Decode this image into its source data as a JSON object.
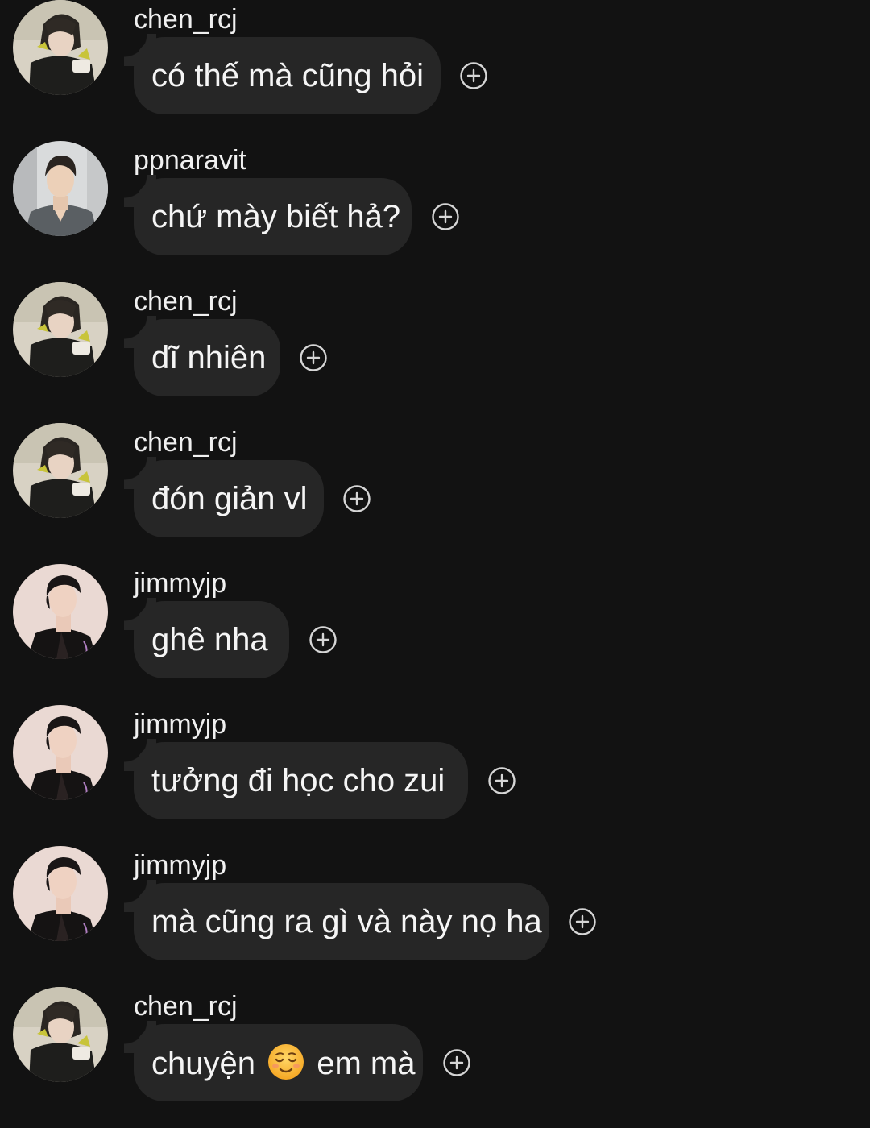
{
  "messages": [
    {
      "username": "chen_rcj",
      "text": "có thế mà cũng hỏi",
      "avatar": "chen-avatar"
    },
    {
      "username": "ppnaravit",
      "text": "chứ mày biết hả?",
      "avatar": "ppnaravit-avatar"
    },
    {
      "username": "chen_rcj",
      "text": "dĩ nhiên",
      "avatar": "chen-avatar"
    },
    {
      "username": "chen_rcj",
      "text": "đón giản vl",
      "avatar": "chen-avatar"
    },
    {
      "username": "jimmyjp",
      "text": "ghê nha",
      "avatar": "jimmy-avatar"
    },
    {
      "username": "jimmyjp",
      "text": "tưởng đi học cho zui",
      "avatar": "jimmy-avatar"
    },
    {
      "username": "jimmyjp",
      "text": "mà cũng ra gì và này nọ ha",
      "avatar": "jimmy-avatar"
    },
    {
      "username": "chen_rcj",
      "text_before": "chuyện",
      "emoji": "relieved-face-emoji",
      "text_after": "em mà",
      "avatar": "chen-avatar"
    }
  ],
  "colors": {
    "background": "#121212",
    "bubble": "#262626",
    "text": "#f5f5f5",
    "icon": "#d6d6d6"
  },
  "icons": {
    "react": "add-reaction-icon"
  }
}
